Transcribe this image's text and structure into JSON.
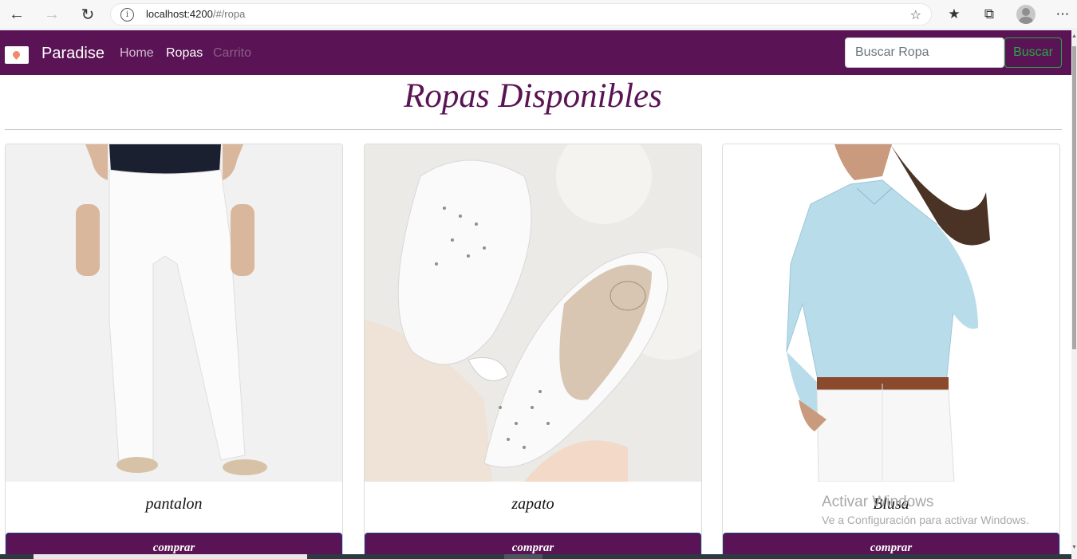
{
  "browser": {
    "url_host": "localhost:4200",
    "url_path": "/#/ropa",
    "icons": [
      "back-arrow-icon",
      "forward-arrow-icon",
      "reload-icon",
      "info-icon",
      "add-favorite-icon",
      "favorites-icon",
      "collections-icon",
      "profile-avatar",
      "more-menu-icon"
    ]
  },
  "navbar": {
    "brand": "Paradise",
    "links": [
      {
        "label": "Home",
        "color": "#d4bcd1"
      },
      {
        "label": "Ropas",
        "color": "#ffffff"
      },
      {
        "label": "Carrito",
        "color": "#8a5f86"
      }
    ],
    "search_placeholder": "Buscar Ropa",
    "search_button": "Buscar",
    "bg_color": "#5a1354",
    "accent_color": "#28a745"
  },
  "main": {
    "title": "Ropas Disponibles",
    "products": [
      {
        "name": "pantalon",
        "button": "comprar",
        "image": "white-pants-photo"
      },
      {
        "name": "zapato",
        "button": "comprar",
        "image": "white-shoes-photo"
      },
      {
        "name": "Blusa",
        "button": "comprar",
        "image": "light-blue-blouse-photo"
      }
    ]
  },
  "watermark": {
    "line1": "Activar Windows",
    "line2": "Ve a Configuración para activar Windows."
  }
}
